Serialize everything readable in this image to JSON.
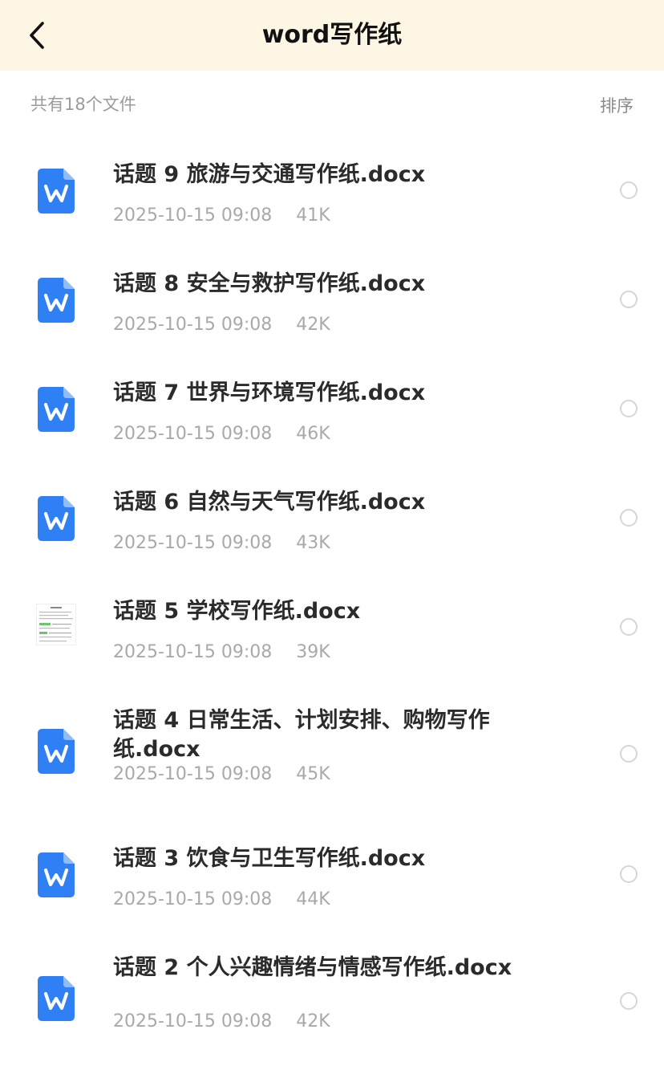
{
  "header": {
    "back_icon": "chevron-left-icon",
    "title": "word写作纸"
  },
  "summary": "共有18个文件",
  "sort_label": "排序",
  "colors": {
    "header_bg": "#fdf6e4",
    "word_icon": "#2f7ff5",
    "radio_border": "#d6d6d6"
  },
  "files": [
    {
      "name": "话题 9 旅游与交通写作纸.docx",
      "date": "2025-10-15 09:08",
      "size": "41K",
      "icon": "word-doc-icon"
    },
    {
      "name": "话题 8 安全与救护写作纸.docx",
      "date": "2025-10-15 09:08",
      "size": "42K",
      "icon": "word-doc-icon"
    },
    {
      "name": "话题 7 世界与环境写作纸.docx",
      "date": "2025-10-15 09:08",
      "size": "46K",
      "icon": "word-doc-icon"
    },
    {
      "name": "话题 6 自然与天气写作纸.docx",
      "date": "2025-10-15 09:08",
      "size": "43K",
      "icon": "word-doc-icon"
    },
    {
      "name": "话题 5 学校写作纸.docx",
      "date": "2025-10-15 09:08",
      "size": "39K",
      "icon": "document-thumbnail"
    },
    {
      "name": "话题 4 日常生活、计划安排、购物写作纸.docx",
      "date": "2025-10-15 09:08",
      "size": "45K",
      "icon": "word-doc-icon"
    },
    {
      "name": "话题 3 饮食与卫生写作纸.docx",
      "date": "2025-10-15 09:08",
      "size": "44K",
      "icon": "word-doc-icon"
    },
    {
      "name": "话题 2 个人兴趣情绪与情感写作纸.docx",
      "date": "2025-10-15 09:08",
      "size": "42K",
      "icon": "word-doc-icon"
    }
  ]
}
